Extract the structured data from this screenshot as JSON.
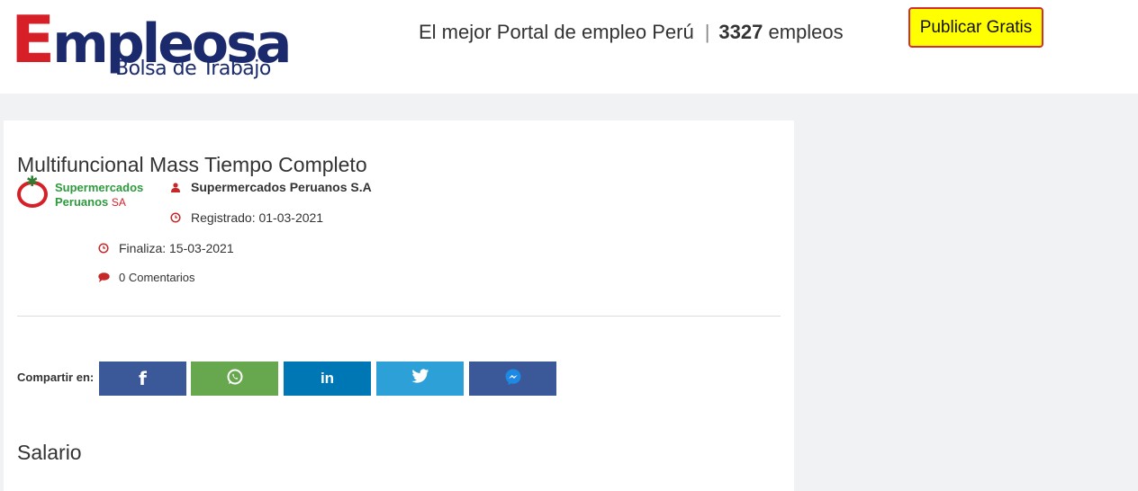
{
  "header": {
    "logo_initial": "E",
    "logo_rest": "mpleosa",
    "logo_subtitle": "Bolsa de Trabajo",
    "tagline": "El mejor Portal de empleo Perú",
    "separator": "|",
    "job_count": "3327",
    "job_count_suffix": "empleos",
    "publish_label": "Publicar Gratis"
  },
  "job": {
    "title": "Multifuncional Mass Tiempo Completo",
    "company_logo_line1": "Supermercados",
    "company_logo_line2": "Peruanos",
    "company_logo_sa": "SA",
    "company_name": "Supermercados Peruanos S.A",
    "registered": "Registrado: 01-03-2021",
    "ends": "Finaliza: 15-03-2021",
    "comments": "0 Comentarios",
    "icons": {
      "company": "user-icon",
      "registered": "clock-icon",
      "ends": "clock-icon",
      "comments": "comment-icon"
    }
  },
  "share": {
    "label": "Compartir en:",
    "buttons": [
      {
        "name": "facebook",
        "glyph": "f",
        "color": "#3b5998"
      },
      {
        "name": "whatsapp",
        "glyph": "whatsapp-icon",
        "color": "#67a74e"
      },
      {
        "name": "linkedin",
        "glyph": "in",
        "color": "#0077b5"
      },
      {
        "name": "twitter",
        "glyph": "twitter-icon",
        "color": "#2ca0d7"
      },
      {
        "name": "messenger",
        "glyph": "messenger-icon",
        "color": "#3b5998"
      }
    ]
  },
  "salary": {
    "heading": "Salario"
  },
  "colors": {
    "accent_red": "#d61f26",
    "logo_navy": "#1a2a6c",
    "publish_bg": "#ffff00",
    "publish_border": "#d32f2f"
  }
}
